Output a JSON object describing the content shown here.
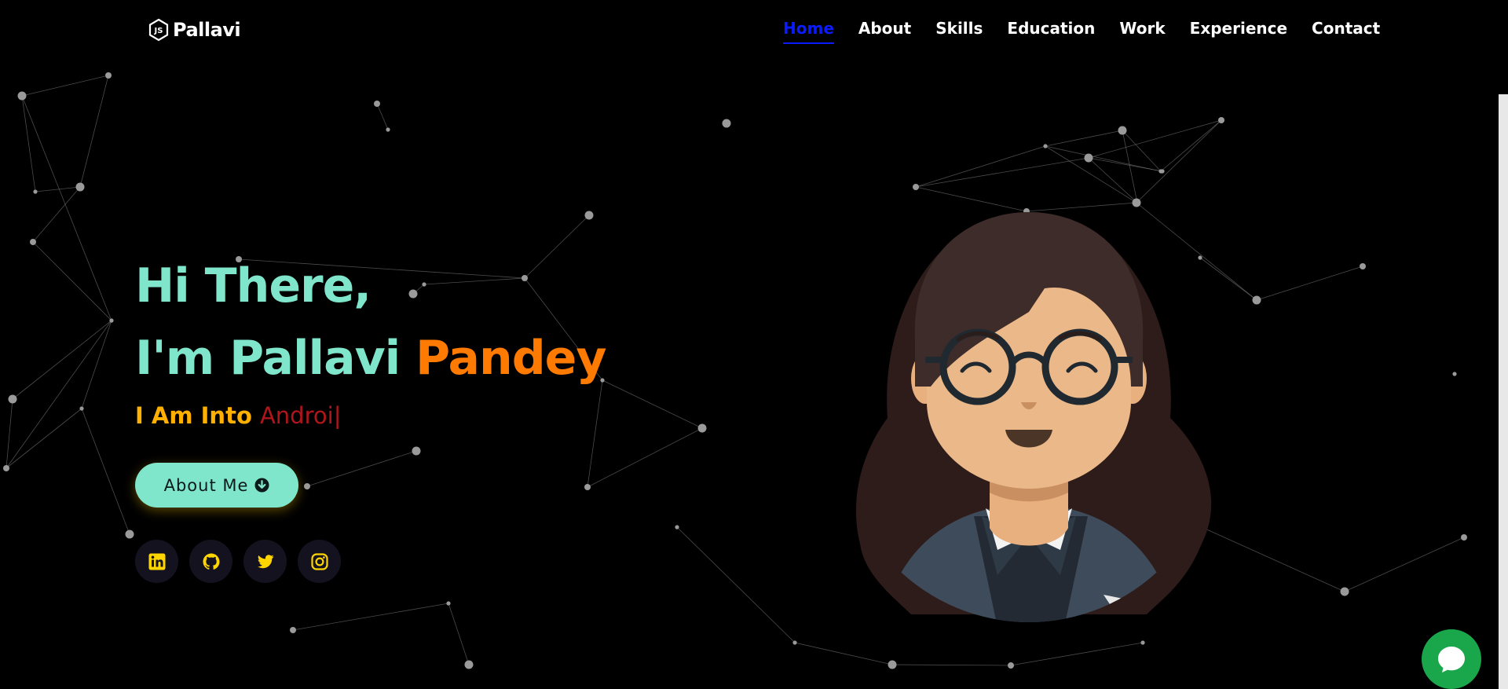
{
  "brand": {
    "name": "Pallavi",
    "logo_icon": "js-hexagon-icon"
  },
  "nav": {
    "items": [
      {
        "label": "Home",
        "active": true
      },
      {
        "label": "About"
      },
      {
        "label": "Skills"
      },
      {
        "label": "Education"
      },
      {
        "label": "Work"
      },
      {
        "label": "Experience"
      },
      {
        "label": "Contact"
      }
    ]
  },
  "hero": {
    "greeting": "Hi There,",
    "intro": "I'm Pallavi ",
    "surname": "Pandey",
    "typing_prefix": "I Am Into ",
    "typing_text": "Androi",
    "typing_cursor": "|",
    "button_label": "About Me",
    "button_icon": "arrow-circle-down-icon"
  },
  "socials": [
    {
      "name": "linkedin-icon"
    },
    {
      "name": "github-icon"
    },
    {
      "name": "twitter-icon"
    },
    {
      "name": "instagram-icon"
    }
  ],
  "chat": {
    "icon": "chat-bubble-icon"
  },
  "colors": {
    "background": "#000000",
    "heading": "#7fe6cc",
    "accent": "#ff7a00",
    "typing_prefix": "#ffb000",
    "typing_text": "#b0151b",
    "nav_active": "#0a1cff",
    "social_icon": "#ffd500",
    "chat": "#1aa64a"
  }
}
